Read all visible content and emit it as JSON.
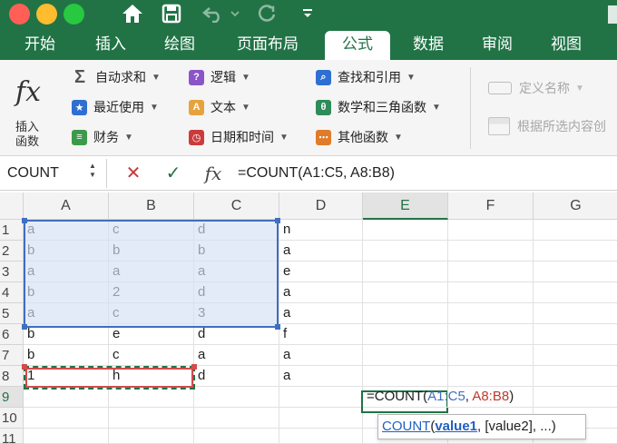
{
  "window": {
    "titlebar_color": "#217346",
    "buttons": [
      {
        "name": "close",
        "color": "#ff5f57"
      },
      {
        "name": "minimize",
        "color": "#febc2e"
      },
      {
        "name": "zoom",
        "color": "#28c840"
      }
    ],
    "quick_access": [
      "home-icon",
      "save-icon",
      "undo-icon",
      "chevron-down-icon",
      "redo-icon",
      "customize-icon"
    ]
  },
  "ribbon_tabs": [
    "开始",
    "插入",
    "绘图",
    "页面布局",
    "公式",
    "数据",
    "审阅",
    "视图"
  ],
  "active_tab": "公式",
  "ribbon": {
    "insert_function": {
      "icon": "fx",
      "label_line1": "插入",
      "label_line2": "函数"
    },
    "col1": [
      {
        "icon": "autosum-icon",
        "glyph": "Σ",
        "color": "#555555",
        "label": "自动求和"
      },
      {
        "icon": "recent-used-icon",
        "glyph": "★",
        "color": "#2f6fd1",
        "label": "最近使用"
      },
      {
        "icon": "financial-icon",
        "glyph": "≡",
        "color": "#3c9a4a",
        "label": "财务"
      }
    ],
    "col2": [
      {
        "icon": "logical-icon",
        "glyph": "?",
        "color": "#8a55c7",
        "label": "逻辑"
      },
      {
        "icon": "text-icon",
        "glyph": "A",
        "color": "#e6a23c",
        "label": "文本"
      },
      {
        "icon": "date-time-icon",
        "glyph": "◷",
        "color": "#cc3b3b",
        "label": "日期和时间"
      }
    ],
    "col3": [
      {
        "icon": "lookup-reference-icon",
        "glyph": "⌕",
        "color": "#2f6fd1",
        "label": "查找和引用"
      },
      {
        "icon": "math-trig-icon",
        "glyph": "θ",
        "color": "#2e8b5a",
        "label": "数学和三角函数"
      },
      {
        "icon": "more-functions-icon",
        "glyph": "⋯",
        "color": "#e07b2a",
        "label": "其他函数"
      }
    ],
    "names": {
      "define_name": "定义名称",
      "create_from_selection": "根据所选内容创"
    }
  },
  "formula_bar": {
    "name_box": "COUNT",
    "cancel_glyph": "✕",
    "enter_glyph": "✓",
    "fx_glyph": "fx",
    "formula": "=COUNT(A1:C5,  A8:B8)"
  },
  "sheet": {
    "columns": [
      "A",
      "B",
      "C",
      "D",
      "E",
      "F",
      "G"
    ],
    "rows": [
      "1",
      "2",
      "3",
      "4",
      "5",
      "6",
      "7",
      "8",
      "9",
      "10",
      "11"
    ],
    "cells": [
      [
        "a",
        "c",
        "d",
        "n"
      ],
      [
        "b",
        "b",
        "b",
        "a"
      ],
      [
        "a",
        "a",
        "a",
        "e"
      ],
      [
        "b",
        "2",
        "d",
        "a"
      ],
      [
        "a",
        "c",
        "3",
        "a"
      ],
      [
        "b",
        "e",
        "d",
        "f"
      ],
      [
        "b",
        "c",
        "a",
        "a"
      ],
      [
        "1",
        "h",
        "d",
        "a"
      ],
      [
        "",
        "",
        "",
        ""
      ],
      [
        "",
        "",
        "",
        ""
      ],
      [
        "",
        "",
        "",
        ""
      ]
    ],
    "editing_cell": {
      "prefix": "=COUNT(",
      "ref1": "A1:C5",
      "sep": ",  ",
      "ref2": "A8:B8",
      "suffix": ")"
    },
    "tooltip": {
      "fn": "COUNT",
      "open": "(",
      "arg1": "value1",
      "rest": ", [value2], ...)"
    }
  },
  "colors": {
    "accent_green": "#217346",
    "range1_blue": "#3f6fbf",
    "range2_red": "#d14c4c"
  }
}
